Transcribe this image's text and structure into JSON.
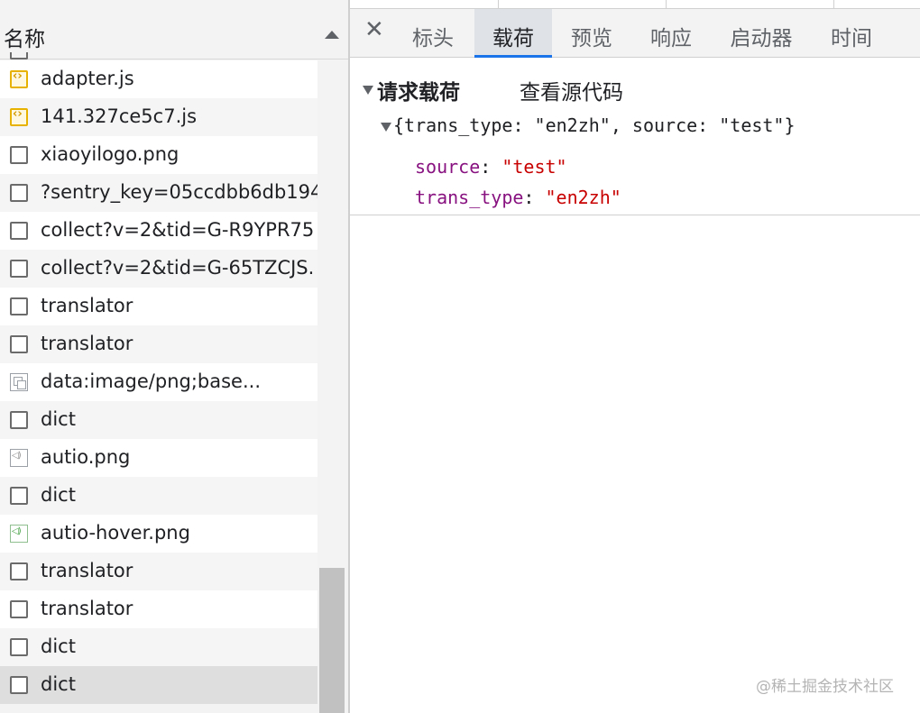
{
  "request_list": {
    "header_title": "名称",
    "rows": [
      {
        "icon": "js-file-icon",
        "name": "adapter.js"
      },
      {
        "icon": "js-file-icon",
        "name": "141.327ce5c7.js"
      },
      {
        "icon": "document-icon",
        "name": "xiaoyilogo.png"
      },
      {
        "icon": "document-icon",
        "name": "?sentry_key=05ccdbb6db194"
      },
      {
        "icon": "document-icon",
        "name": "collect?v=2&tid=G-R9YPR75"
      },
      {
        "icon": "document-icon",
        "name": "collect?v=2&tid=G-65TZCJS."
      },
      {
        "icon": "document-icon",
        "name": "translator"
      },
      {
        "icon": "document-icon",
        "name": "translator"
      },
      {
        "icon": "data-image-icon",
        "name": "data:image/png;base..."
      },
      {
        "icon": "document-icon",
        "name": "dict"
      },
      {
        "icon": "audio-image-icon",
        "name": "autio.png"
      },
      {
        "icon": "document-icon",
        "name": "dict"
      },
      {
        "icon": "audio-image-icon-green",
        "name": "autio-hover.png"
      },
      {
        "icon": "document-icon",
        "name": "translator"
      },
      {
        "icon": "document-icon",
        "name": "translator"
      },
      {
        "icon": "document-icon",
        "name": "dict"
      },
      {
        "icon": "document-icon",
        "name": "dict"
      }
    ]
  },
  "detail": {
    "close_label": "✕",
    "tabs": [
      {
        "label": "标头"
      },
      {
        "label": "载荷",
        "active": true
      },
      {
        "label": "预览"
      },
      {
        "label": "响应"
      },
      {
        "label": "启动器"
      },
      {
        "label": "时间"
      }
    ],
    "payload": {
      "section_title": "请求载荷",
      "view_source": "查看源代码",
      "object_summary": "{trans_type: \"en2zh\", source: \"test\"}",
      "fields": [
        {
          "key": "source",
          "value": "\"test\""
        },
        {
          "key": "trans_type",
          "value": "\"en2zh\""
        }
      ]
    }
  },
  "watermark": "@稀土掘金技术社区",
  "colors": {
    "active_tab_underline": "#1a73e8",
    "json_key": "#881280",
    "json_string": "#c80000"
  }
}
